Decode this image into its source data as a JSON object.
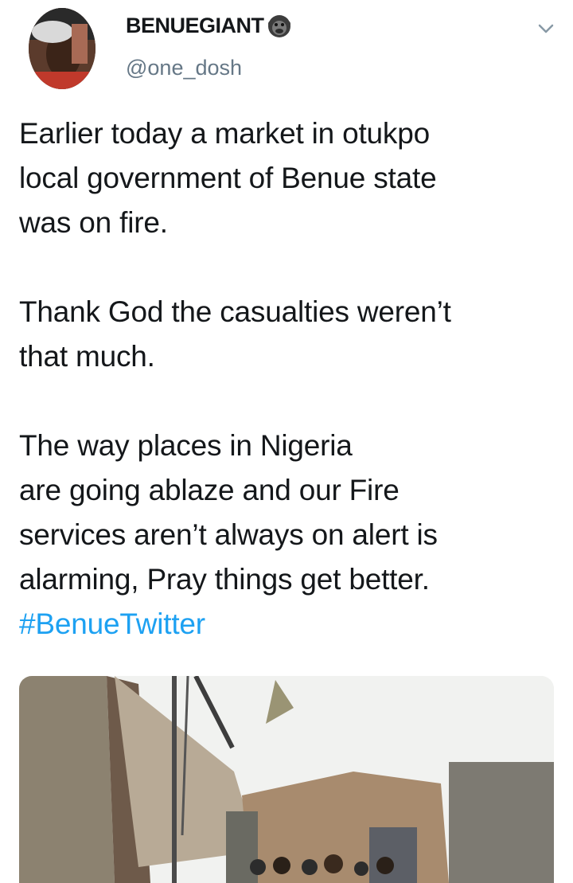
{
  "tweet": {
    "author": {
      "display_name": "BENUEGIANT",
      "name_emoji": "gorilla-icon",
      "handle": "@one_dosh"
    },
    "lines": [
      "Earlier today a market in otukpo",
      "local government of Benue state",
      "was on fire.",
      "",
      "Thank God the casualties weren’t",
      "that much.",
      "",
      "The way places in Nigeria",
      "are going ablaze and our Fire",
      "services aren’t always on alert is",
      "alarming, Pray things get better."
    ],
    "hashtag": "#BenueTwitter",
    "menu_icon": "chevron-down-icon",
    "media": {
      "type": "photo",
      "caption": "market fire scene"
    }
  },
  "colors": {
    "text": "#14171a",
    "secondary": "#657786",
    "link": "#1da1f2",
    "background": "#ffffff"
  }
}
